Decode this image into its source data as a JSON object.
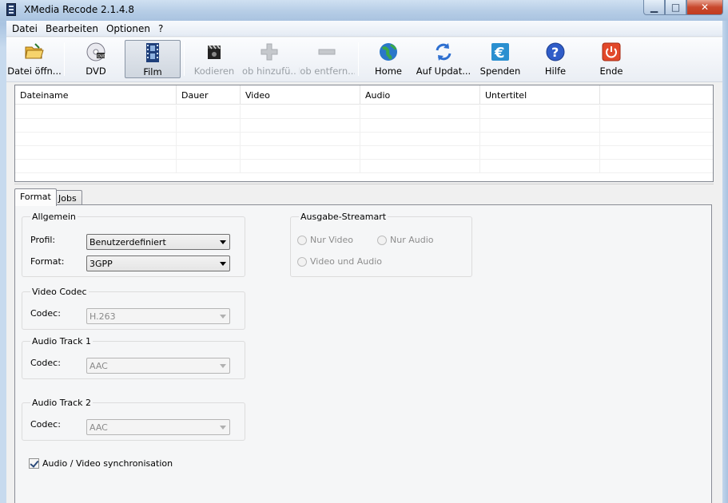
{
  "window": {
    "title": "XMedia Recode 2.1.4.8"
  },
  "menu": [
    "Datei",
    "Bearbeiten",
    "Optionen",
    "?"
  ],
  "toolbar": {
    "open_file": "Datei öffn...",
    "dvd": "DVD",
    "film": "Film",
    "encode": "Kodieren",
    "add_job": "Job hinzufü...",
    "remove_job": "Job entfern...",
    "home": "Home",
    "update": "Auf Updat...",
    "donate": "Spenden",
    "help": "Hilfe",
    "exit": "Ende"
  },
  "filelist": {
    "columns": [
      "Dateiname",
      "Dauer",
      "Video",
      "Audio",
      "Untertitel",
      ""
    ],
    "rows": []
  },
  "tabs": [
    "Format",
    "Jobs"
  ],
  "selected_tab": "Format",
  "format": {
    "general": {
      "title": "Allgemein",
      "profile_label": "Profil:",
      "profile_value": "Benutzerdefiniert",
      "format_label": "Format:",
      "format_value": "3GPP"
    },
    "video_codec": {
      "title": "Video Codec",
      "codec_label": "Codec:",
      "codec_value": "H.263"
    },
    "audio_track_1": {
      "title": "Audio Track 1",
      "codec_label": "Codec:",
      "codec_value": "AAC"
    },
    "audio_track_2": {
      "title": "Audio Track 2",
      "codec_label": "Codec:",
      "codec_value": "AAC"
    },
    "output_stream": {
      "title": "Ausgabe-Streamart",
      "only_video": "Nur Video",
      "only_audio": "Nur Audio",
      "video_and_audio": "Video und Audio"
    },
    "sync_label": "Audio / Video synchronisation",
    "sync_checked": true
  }
}
